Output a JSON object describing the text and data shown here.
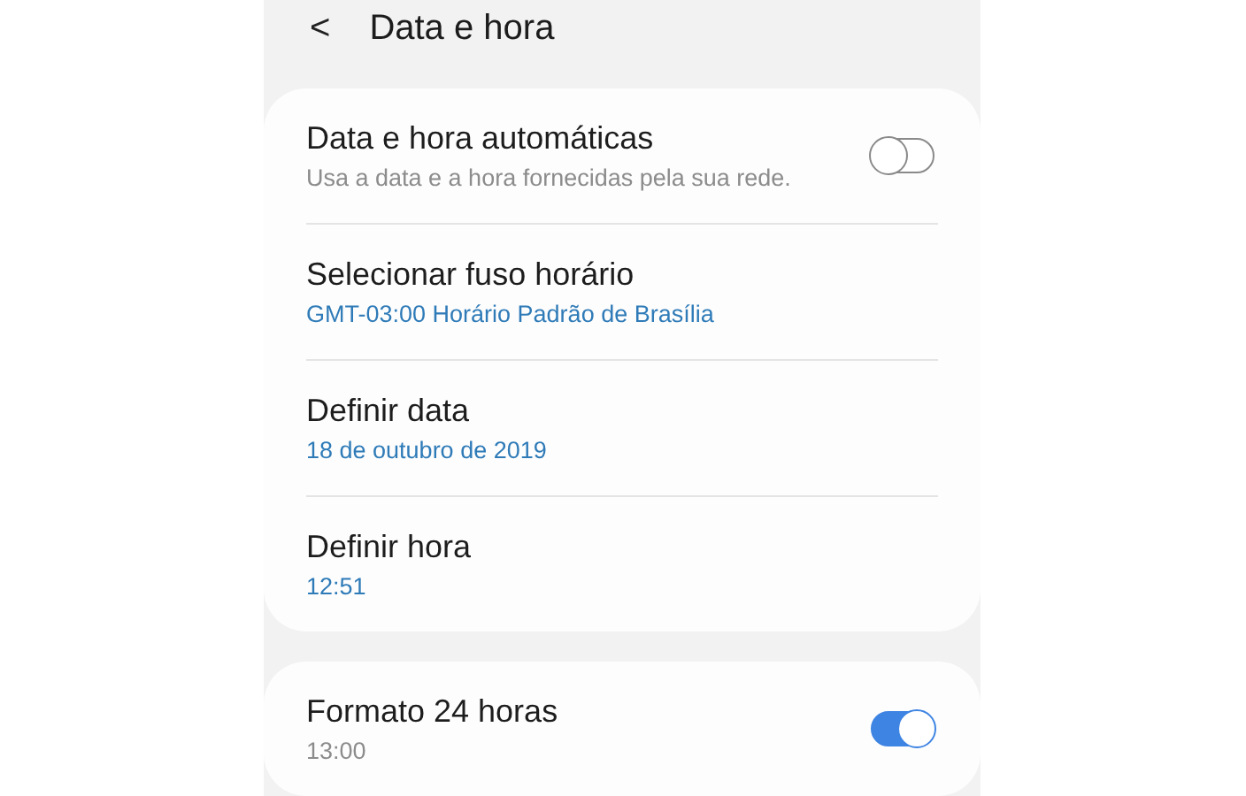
{
  "header": {
    "back": "<",
    "title": "Data e hora"
  },
  "groups": [
    {
      "items": [
        {
          "kind": "toggle",
          "title": "Data e hora automáticas",
          "subtitle": "Usa a data e a hora fornecidas pela sua rede.",
          "subtitle_highlighted": false,
          "on": false
        },
        {
          "kind": "link",
          "title": "Selecionar fuso horário",
          "subtitle": "GMT-03:00 Horário Padrão de Brasília",
          "subtitle_highlighted": true
        },
        {
          "kind": "link",
          "title": "Definir data",
          "subtitle": "18 de outubro de 2019",
          "subtitle_highlighted": true
        },
        {
          "kind": "link",
          "title": "Definir hora",
          "subtitle": "12:51",
          "subtitle_highlighted": true
        }
      ]
    },
    {
      "items": [
        {
          "kind": "toggle",
          "title": "Formato 24 horas",
          "subtitle": "13:00",
          "subtitle_highlighted": false,
          "on": true
        }
      ]
    }
  ]
}
